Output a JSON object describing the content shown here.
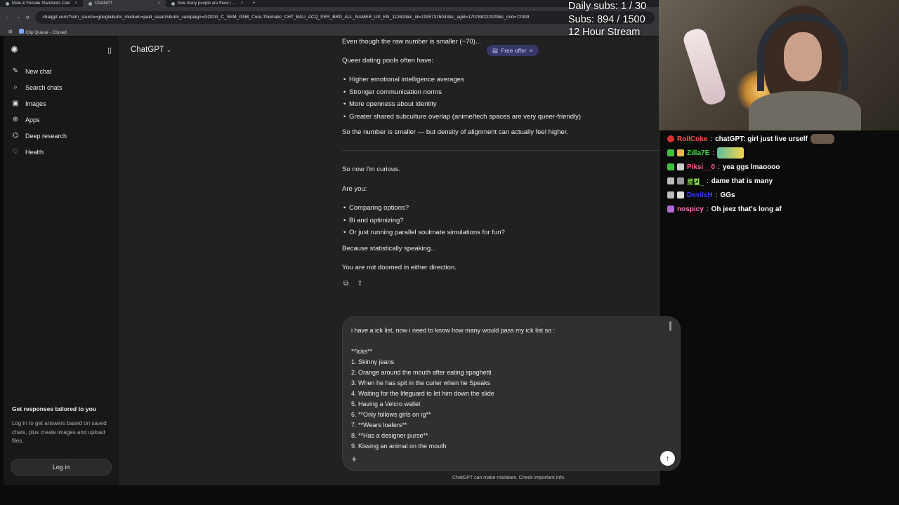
{
  "browser": {
    "tabs": [
      {
        "label": "Male & Female Standards Calc",
        "active": false
      },
      {
        "label": "ChatGPT",
        "active": true
      },
      {
        "label": "how many people are there i ...",
        "active": false
      }
    ],
    "url": "chatgpt.com/?utm_source=google&utm_medium=paid_search&utm_campaign=GOOG_C_SEM_GNB_Core-Thematic_CHT_BAU_ACQ_PER_BRD_ALL_NAMER_US_EN_112624&c_id=21957315043&c_agid=170788222029&c_crid=72309",
    "bookmark": "Clip Queue - Closed"
  },
  "sidebar": {
    "items": [
      {
        "label": "New chat",
        "icon": "edit-icon"
      },
      {
        "label": "Search chats",
        "icon": "search-icon"
      },
      {
        "label": "Images",
        "icon": "image-icon"
      },
      {
        "label": "Apps",
        "icon": "apps-icon"
      },
      {
        "label": "Deep research",
        "icon": "research-icon"
      },
      {
        "label": "Health",
        "icon": "heart-icon"
      }
    ],
    "promo_title": "Get responses tailored to you",
    "promo_text": "Log in to get answers based on saved chats, plus create images and upload files.",
    "login_label": "Log in"
  },
  "header": {
    "model": "ChatGPT",
    "free_offer": "Free offer"
  },
  "conversation": {
    "line_top": "Even though the raw number is smaller (~70)...",
    "queer_intro": "Queer dating pools often have:",
    "queer_bullets": [
      "Higher emotional intelligence averages",
      "Stronger communication norms",
      "More openness about identity",
      "Greater shared subculture overlap (anime/tech spaces are very queer-friendly)"
    ],
    "summary": "So the number is smaller — but density of alignment can actually feel higher.",
    "curious": "So now I'm curious.",
    "are_you": "Are you:",
    "options": [
      "Comparing options?",
      "Bi and optimizing?",
      "Or just running parallel soulmate simulations for fun?"
    ],
    "statistically": "Because statistically speaking...",
    "not_doomed": "You are not doomed in either direction."
  },
  "composer": {
    "text": "i have a ick list, now i need to know how many would pass my ick list so :\n\n**Icks**\n1. Skinny jeans\n2. Orange around the mouth after eating spaghetti\n3. When he has spit in the curler when he Speaks\n4. Waiting for the lifeguard to let him down the slide\n5. Having a Velcro wallet\n6. **Only follows girls on ig**\n7. **Wears loafers**\n8. **Has a designer purse**\n9. Kissing an animal on the mouth",
    "disclaimer": "ChatGPT can make mistakes. Check important info."
  },
  "overlay": {
    "daily_subs": "Daily subs: 1 / 30",
    "subs": "Subs: 894 / 1500",
    "stream": "12 Hour Stream"
  },
  "chat": [
    {
      "user": "RollCoke",
      "color": "#ff4d4d",
      "message": "chatGPT: girl just live urself",
      "emote": true
    },
    {
      "user": "Zilla7E",
      "color": "#3fd63f",
      "message": "",
      "emote": true
    },
    {
      "user": "Piksi__0",
      "color": "#ff5a8a",
      "message": "yea ggs lmaoooo",
      "emote": false
    },
    {
      "user": "로컬_",
      "color": "#9aff5a",
      "message": "dame that is many",
      "emote": false
    },
    {
      "user": "DevilsH",
      "color": "#3a3aff",
      "message": "GGs",
      "emote": false
    },
    {
      "user": "nospicy",
      "color": "#ff6fb5",
      "message": "Oh jeez that's long af",
      "emote": false
    }
  ]
}
